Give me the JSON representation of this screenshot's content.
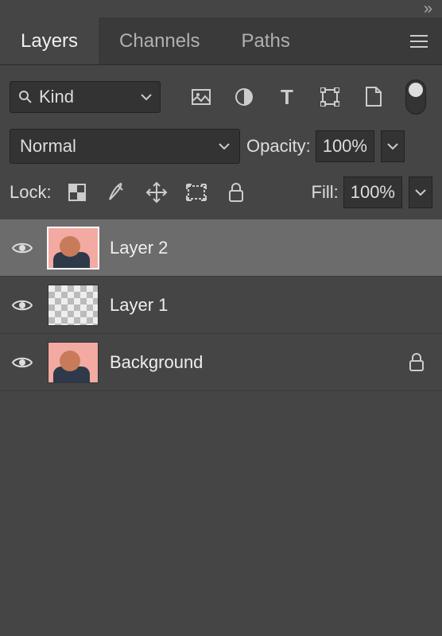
{
  "tabs": {
    "layers": "Layers",
    "channels": "Channels",
    "paths": "Paths"
  },
  "filter": {
    "kind_label": "Kind"
  },
  "blend": {
    "mode": "Normal",
    "opacity_label": "Opacity:",
    "opacity_value": "100%"
  },
  "lock": {
    "label": "Lock:",
    "fill_label": "Fill:",
    "fill_value": "100%"
  },
  "layers": [
    {
      "name": "Layer 2",
      "visible": true,
      "selected": true,
      "thumb": "portrait",
      "locked": false
    },
    {
      "name": "Layer 1",
      "visible": true,
      "selected": false,
      "thumb": "transparent",
      "locked": false
    },
    {
      "name": "Background",
      "visible": true,
      "selected": false,
      "thumb": "portrait",
      "locked": true
    }
  ]
}
